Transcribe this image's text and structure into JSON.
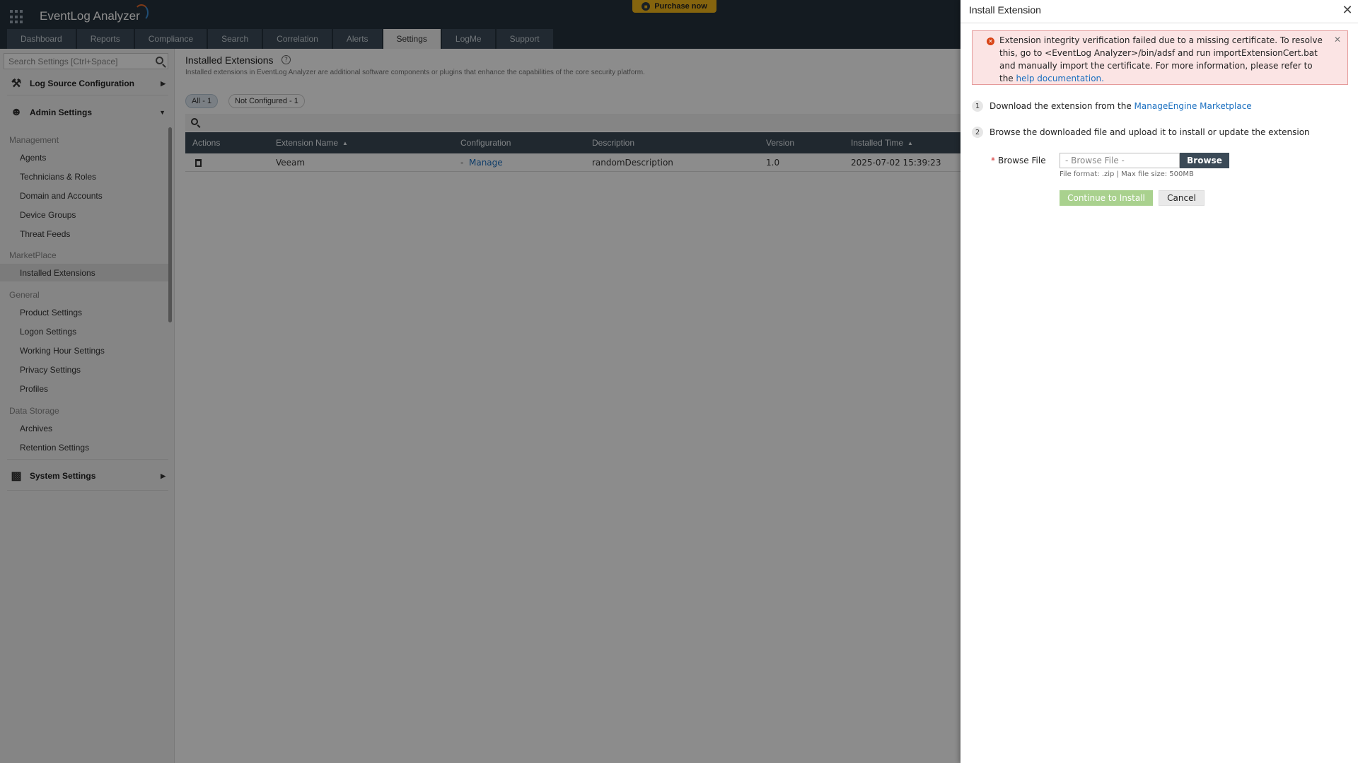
{
  "header": {
    "app_name": "EventLog Analyzer",
    "purchase_label": "Purchase now",
    "tabs": [
      "Dashboard",
      "Reports",
      "Compliance",
      "Search",
      "Correlation",
      "Alerts",
      "Settings",
      "LogMe",
      "Support"
    ],
    "active_tab": "Settings",
    "brand_color": "#25323d",
    "purchase_color": "#f3b71a"
  },
  "sidebar": {
    "search_placeholder": "Search Settings [Ctrl+Space]",
    "sections": {
      "log_source": "Log Source Configuration",
      "admin": "Admin Settings",
      "system": "System Settings"
    },
    "groups": {
      "management": "Management",
      "marketplace": "MarketPlace",
      "general": "General",
      "data_storage": "Data Storage"
    },
    "items": {
      "agents": "Agents",
      "technicians": "Technicians & Roles",
      "domain": "Domain and Accounts",
      "device_groups": "Device Groups",
      "threat_feeds": "Threat Feeds",
      "installed_extensions": "Installed Extensions",
      "product_settings": "Product Settings",
      "logon_settings": "Logon Settings",
      "working_hour": "Working Hour Settings",
      "privacy": "Privacy Settings",
      "profiles": "Profiles",
      "archives": "Archives",
      "retention": "Retention Settings"
    }
  },
  "main": {
    "title": "Installed Extensions",
    "description": "Installed extensions in EventLog Analyzer are additional software components or plugins that enhance the capabilities of the core security platform.",
    "filters": {
      "all": "All - 1",
      "not_configured": "Not Configured - 1"
    },
    "columns": {
      "actions": "Actions",
      "name": "Extension Name",
      "configuration": "Configuration",
      "description": "Description",
      "version": "Version",
      "installed_time": "Installed Time"
    },
    "rows": [
      {
        "name": "Veeam",
        "config_prefix": "-",
        "config_link": "Manage",
        "description": "randomDescription",
        "version": "1.0",
        "installed_time": "2025-07-02 15:39:23"
      }
    ]
  },
  "drawer": {
    "title": "Install Extension",
    "alert": {
      "text_before_link": "Extension integrity verification failed due to a missing certificate. To resolve this, go to <EventLog Analyzer>/bin/adsf and run importExtensionCert.bat and manually import the certificate. For more information, please refer to the ",
      "link_text": "help documentation.",
      "color": "#fbe4e4"
    },
    "step1": {
      "number": "1",
      "text": "Download the extension from the ",
      "link": "ManageEngine Marketplace"
    },
    "step2": {
      "number": "2",
      "text": "Browse the downloaded file and upload it to install or update the extension"
    },
    "browse": {
      "required_mark": "*",
      "label": "Browse File",
      "placeholder": "- Browse File -",
      "button": "Browse",
      "hint": "File format: .zip | Max file size: 500MB"
    },
    "continue_label": "Continue to Install",
    "cancel_label": "Cancel"
  }
}
